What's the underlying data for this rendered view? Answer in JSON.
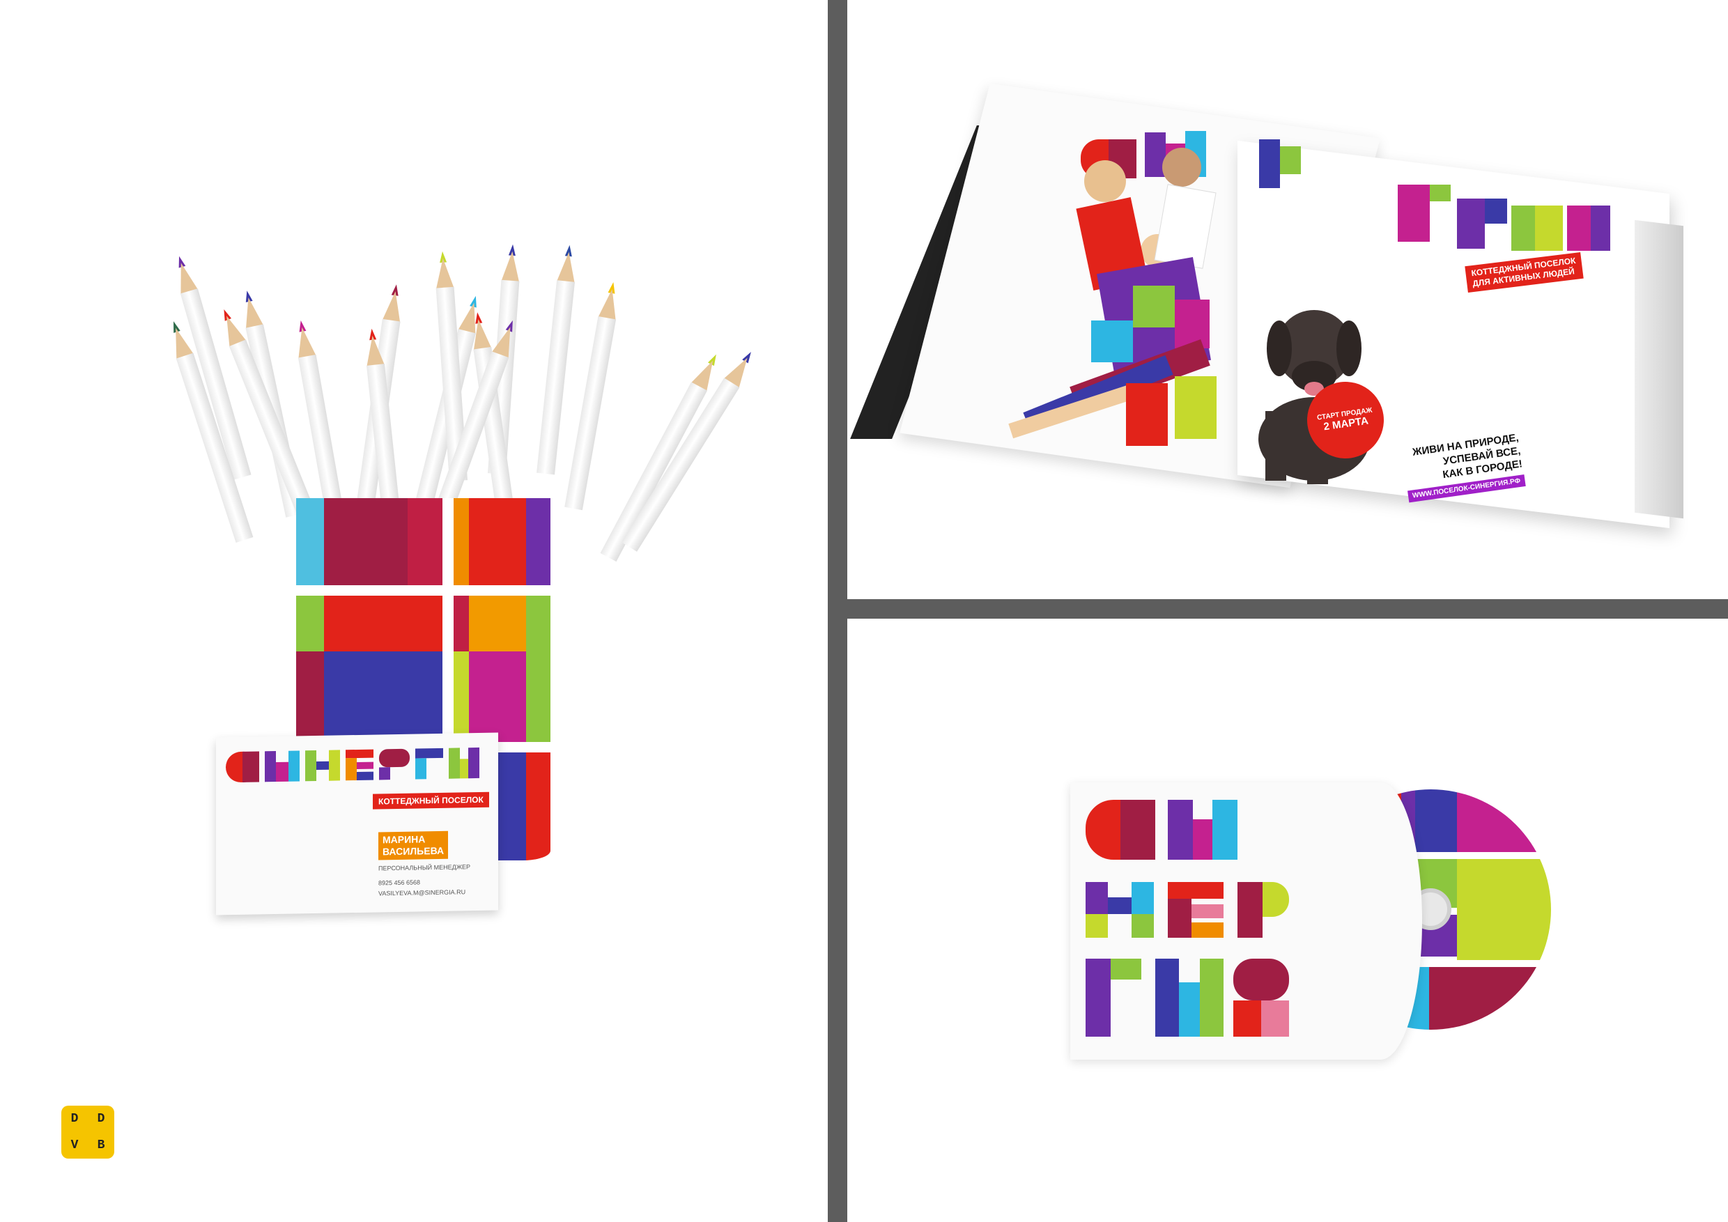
{
  "business_card": {
    "logo_text": "СИНЕРГИЯ",
    "tagline": "КОТТЕДЖНЫЙ ПОСЕЛОК",
    "name_line1": "МАРИНА",
    "name_line2": "ВАСИЛЬЕВА",
    "role": "ПЕРСОНАЛЬНЫЙ МЕНЕДЖЕР",
    "phone": "8925 456 6568",
    "email": "VASILYEVA.M@SINERGIA.RU"
  },
  "magazine": {
    "logo_text": "СИНЕРГИЯ",
    "tagline_line1": "КОТТЕДЖНЫЙ ПОСЕЛОК",
    "tagline_line2": "ДЛЯ АКТИВНЫХ ЛЮДЕЙ",
    "badge_line1": "СТАРТ ПРОДАЖ",
    "badge_line2": "2 МАРТА",
    "slogan_line1": "ЖИВИ НА ПРИРОДЕ,",
    "slogan_line2": "УСПЕВАЙ ВСЕ,",
    "slogan_line3": "КАК В ГОРОДЕ!",
    "url": "WWW.ПОСЕЛОК-СИНЕРГИЯ.РФ"
  },
  "cd_cover": {
    "logo_text": "СИНЕРГИЯ"
  },
  "agency_logo": {
    "letters": [
      "D",
      "D",
      "V",
      "B"
    ],
    "color": "#f5c400"
  },
  "colors": {
    "divider": "#5d5d5d",
    "red": "#e2231a",
    "orange": "#f08c00",
    "purple": "#6d2fa8",
    "magenta": "#c4218f",
    "cyan": "#2db6e2",
    "green": "#8cc63e",
    "lime": "#c5d92d",
    "maroon": "#a01e44",
    "blue": "#3a3aa7"
  }
}
